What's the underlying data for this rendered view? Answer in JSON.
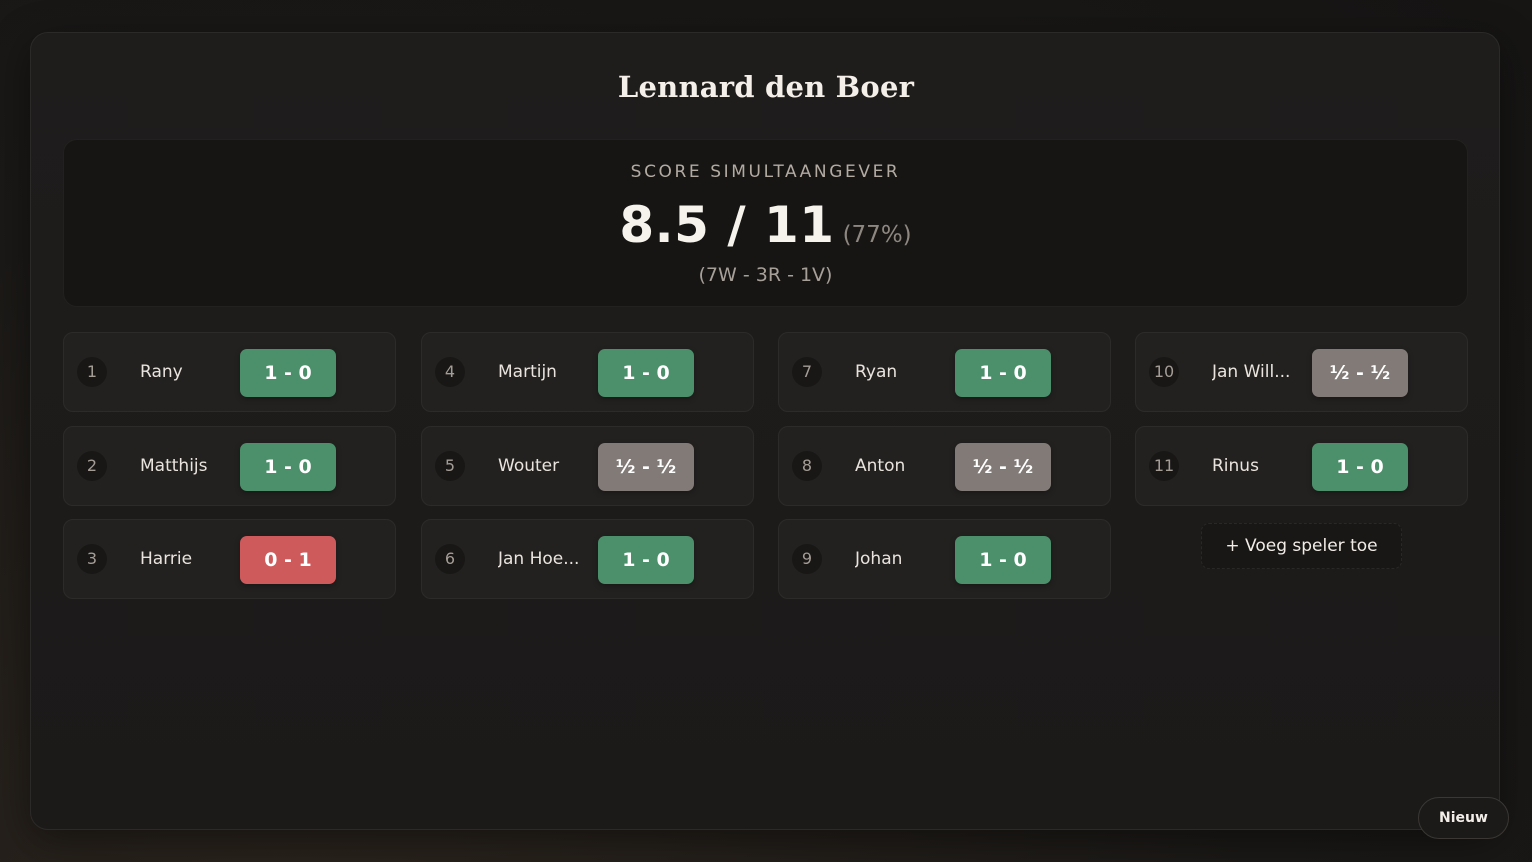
{
  "title": "Lennard den Boer",
  "score": {
    "label": "SCORE SIMULTAANGEVER",
    "main": "8.5 / 11",
    "percent": "(77%)",
    "record": "(7W - 3R - 1V)"
  },
  "players": [
    {
      "number": "1",
      "name": "Rany",
      "result": "1 - 0",
      "status": "win"
    },
    {
      "number": "2",
      "name": "Matthijs",
      "result": "1 - 0",
      "status": "win"
    },
    {
      "number": "3",
      "name": "Harrie",
      "result": "0 - 1",
      "status": "loss"
    },
    {
      "number": "4",
      "name": "Martijn",
      "result": "1 - 0",
      "status": "win"
    },
    {
      "number": "5",
      "name": "Wouter",
      "result": "½ - ½",
      "status": "draw"
    },
    {
      "number": "6",
      "name": "Jan Hoe...",
      "result": "1 - 0",
      "status": "win"
    },
    {
      "number": "7",
      "name": "Ryan",
      "result": "1 - 0",
      "status": "win"
    },
    {
      "number": "8",
      "name": "Anton",
      "result": "½ - ½",
      "status": "draw"
    },
    {
      "number": "9",
      "name": "Johan",
      "result": "1 - 0",
      "status": "win"
    },
    {
      "number": "10",
      "name": "Jan Will...",
      "result": "½ - ½",
      "status": "draw"
    },
    {
      "number": "11",
      "name": "Rinus",
      "result": "1 - 0",
      "status": "win"
    }
  ],
  "buttons": {
    "add_player": "+ Voeg speler toe",
    "new": "Nieuw"
  },
  "colors": {
    "win": "#4b8f6b",
    "draw": "#827a76",
    "loss": "#cf5a5c"
  }
}
